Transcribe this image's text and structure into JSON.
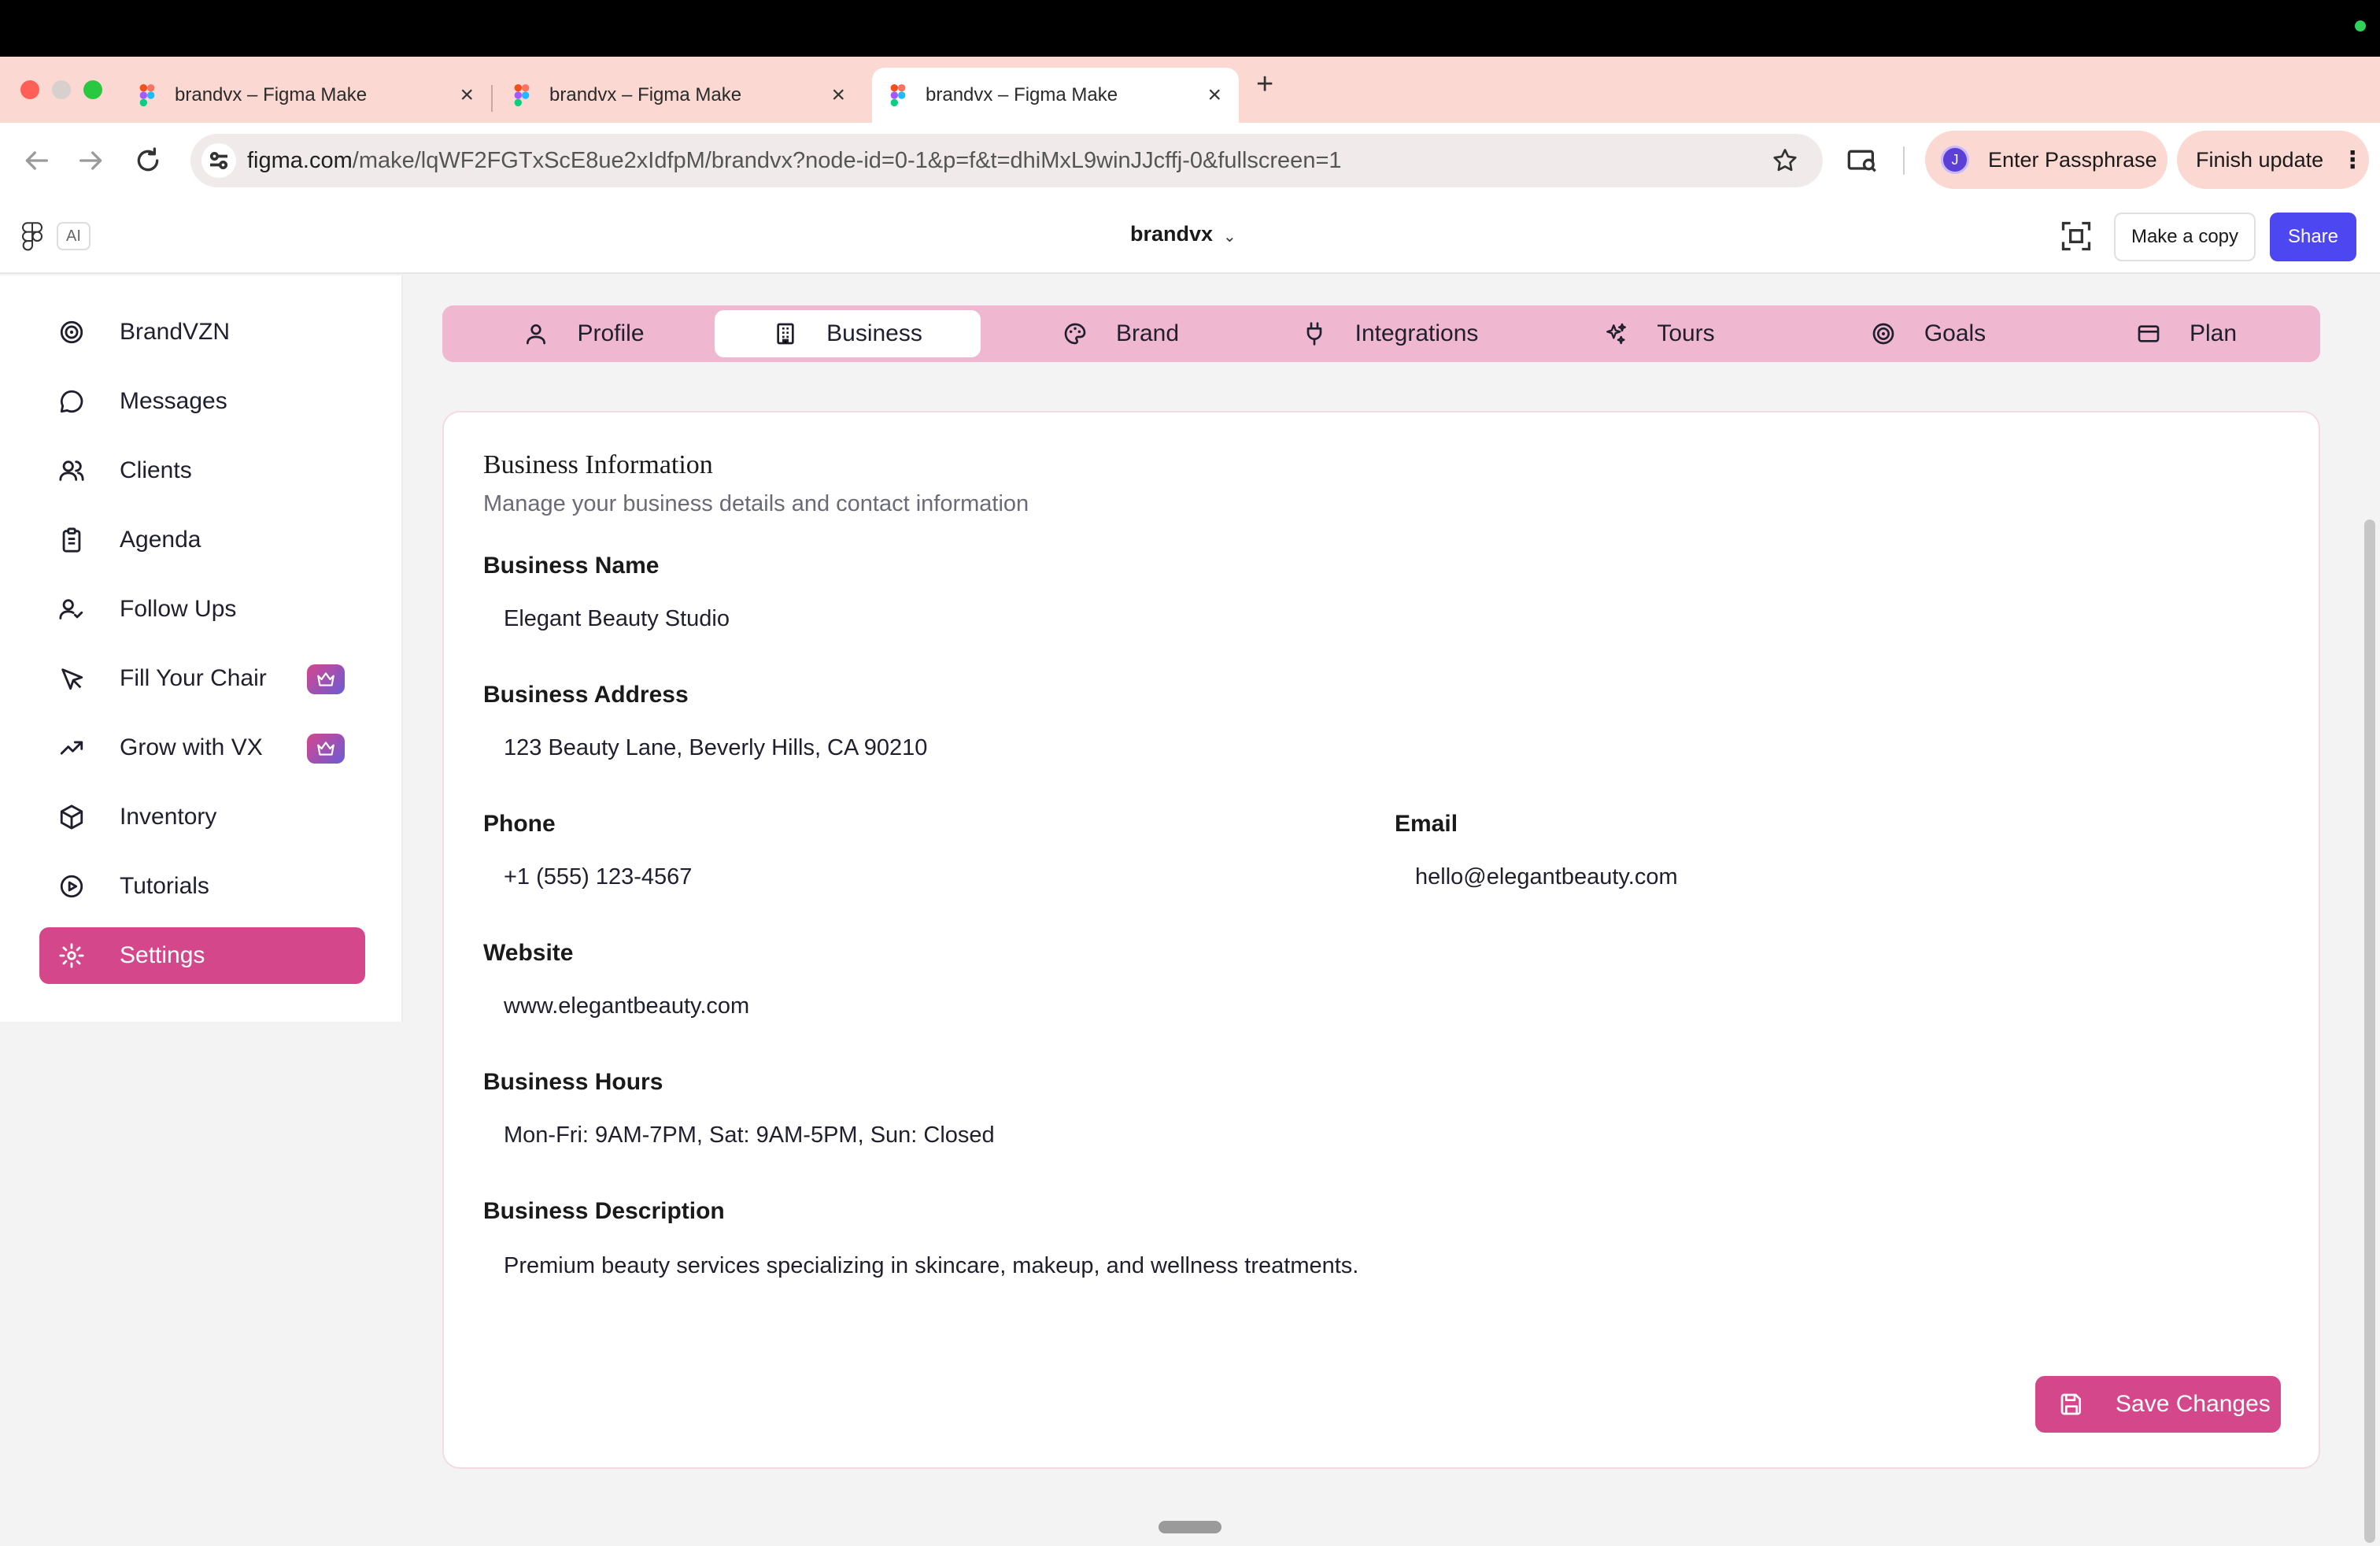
{
  "browser": {
    "tabs": [
      {
        "title": "brandvx – Figma Make"
      },
      {
        "title": "brandvx – Figma Make"
      },
      {
        "title": "brandvx – Figma Make"
      }
    ],
    "url_domain": "figma.com",
    "url_path": "/make/lqWF2FGTxScE8ue2xIdfpM/brandvx?node-id=0-1&p=f&t=dhiMxL9winJJcffj-0&fullscreen=1",
    "profile_initial": "J",
    "passphrase_label": "Enter Passphrase",
    "update_label": "Finish update"
  },
  "figma": {
    "ai_badge": "AI",
    "file_title": "brandvx",
    "make_copy_label": "Make a copy",
    "share_label": "Share"
  },
  "sidebar": {
    "items": [
      {
        "label": "BrandVZN",
        "icon": "target-icon"
      },
      {
        "label": "Messages",
        "icon": "chat-bubble-icon"
      },
      {
        "label": "Clients",
        "icon": "users-icon"
      },
      {
        "label": "Agenda",
        "icon": "clipboard-icon"
      },
      {
        "label": "Follow Ups",
        "icon": "user-check-icon"
      },
      {
        "label": "Fill Your Chair",
        "icon": "cursor-icon",
        "premium": true
      },
      {
        "label": "Grow with VX",
        "icon": "trending-up-icon",
        "premium": true
      },
      {
        "label": "Inventory",
        "icon": "package-icon"
      },
      {
        "label": "Tutorials",
        "icon": "play-circle-icon"
      },
      {
        "label": "Settings",
        "icon": "gear-icon",
        "active": true
      }
    ]
  },
  "settings_tabs": [
    {
      "label": "Profile",
      "icon": "user-icon"
    },
    {
      "label": "Business",
      "icon": "building-icon",
      "active": true
    },
    {
      "label": "Brand",
      "icon": "palette-icon"
    },
    {
      "label": "Integrations",
      "icon": "plug-icon"
    },
    {
      "label": "Tours",
      "icon": "sparkles-icon"
    },
    {
      "label": "Goals",
      "icon": "target-icon"
    },
    {
      "label": "Plan",
      "icon": "credit-card-icon"
    }
  ],
  "business": {
    "title": "Business Information",
    "subtitle": "Manage your business details and contact information",
    "name_label": "Business Name",
    "name_value": "Elegant Beauty Studio",
    "address_label": "Business Address",
    "address_value": "123 Beauty Lane, Beverly Hills, CA 90210",
    "phone_label": "Phone",
    "phone_value": "+1 (555) 123-4567",
    "email_label": "Email",
    "email_value": "hello@elegantbeauty.com",
    "website_label": "Website",
    "website_value": "www.elegantbeauty.com",
    "hours_label": "Business Hours",
    "hours_value": "Mon-Fri: 9AM-7PM, Sat: 9AM-5PM, Sun: Closed",
    "description_label": "Business Description",
    "description_value": "Premium beauty services specializing in skincare, makeup, and wellness treatments.",
    "save_label": "Save Changes"
  },
  "colors": {
    "accent": "#d4478b",
    "tabs_bar": "#f0b8d0",
    "share_button": "#4c47f0",
    "browser_chrome": "#fbd9d2"
  }
}
